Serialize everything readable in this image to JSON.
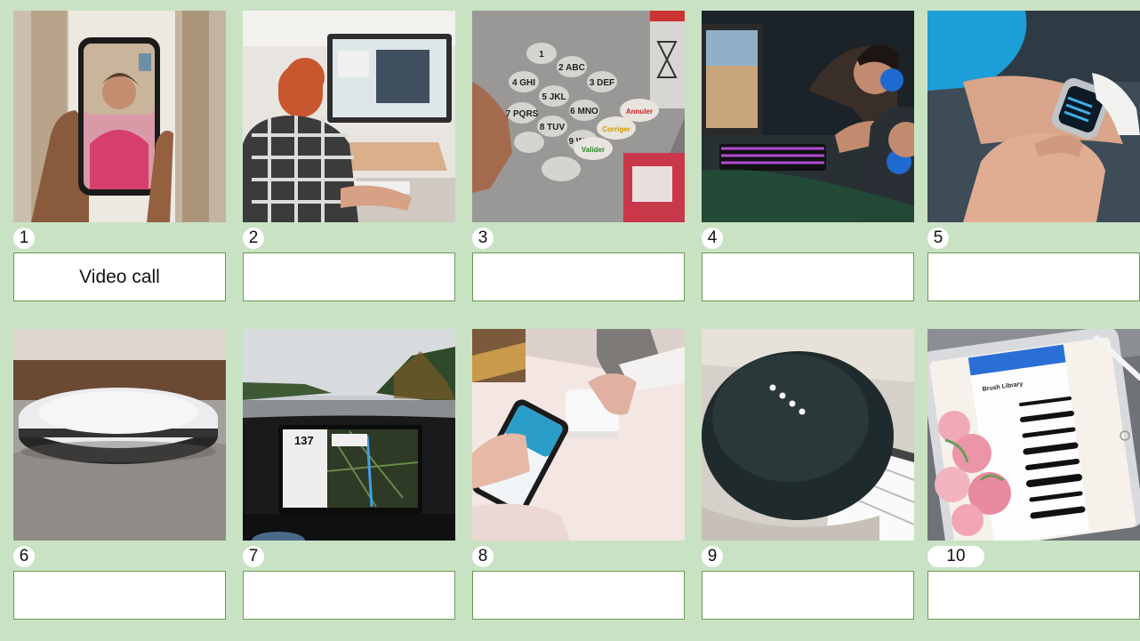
{
  "items": [
    {
      "number": "1",
      "answer": "Video call",
      "image": "video-call-photo"
    },
    {
      "number": "2",
      "answer": "",
      "image": "desktop-computer-photo"
    },
    {
      "number": "3",
      "answer": "",
      "image": "atm-keypad-photo"
    },
    {
      "number": "4",
      "answer": "",
      "image": "gaming-photo"
    },
    {
      "number": "5",
      "answer": "",
      "image": "smartwatch-photo"
    },
    {
      "number": "6",
      "answer": "",
      "image": "robot-vacuum-photo"
    },
    {
      "number": "7",
      "answer": "",
      "image": "car-touchscreen-photo"
    },
    {
      "number": "8",
      "answer": "",
      "image": "contactless-payment-photo"
    },
    {
      "number": "9",
      "answer": "",
      "image": "smart-speaker-photo"
    },
    {
      "number": "10",
      "answer": "",
      "image": "tablet-drawing-photo"
    }
  ],
  "keypad": {
    "keys": [
      "1",
      "2 ABC",
      "3 DEF",
      "4 GHI",
      "5 JKL",
      "6 MNO",
      "7 PQRS",
      "8 TUV",
      "9 WXY"
    ],
    "cancel": "Annuler",
    "correct": "Corriger",
    "valid": "Valider"
  },
  "car_screen": {
    "speed": "137"
  },
  "tablet": {
    "panel_title": "Brush Library"
  },
  "colors": {
    "background": "#c9e2c4",
    "border": "#6a9b4f"
  }
}
